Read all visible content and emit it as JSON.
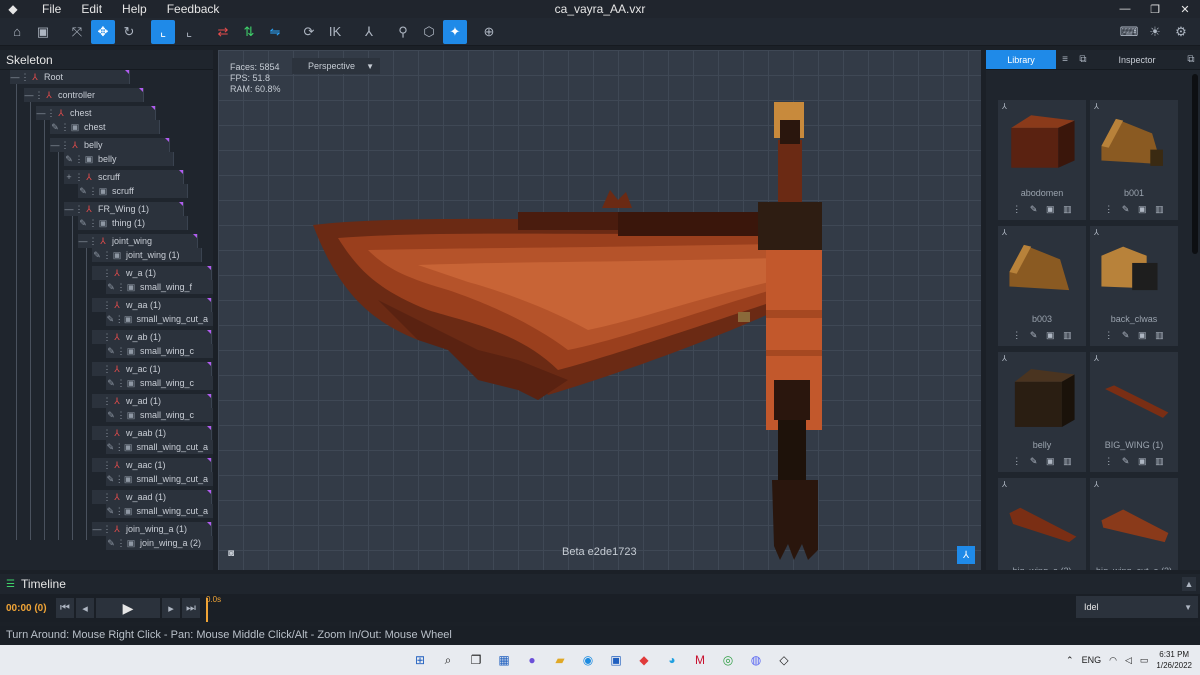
{
  "app": {
    "title": "ca_vayra_AA.vxr",
    "menu": [
      "File",
      "Edit",
      "Help",
      "Feedback"
    ]
  },
  "toolbar": {
    "ik_label": "IK"
  },
  "skeleton": {
    "title": "Skeleton",
    "nodes": [
      {
        "label": "Root"
      },
      {
        "label": "controller"
      },
      {
        "label": "chest"
      },
      {
        "label": "chest"
      },
      {
        "label": "belly"
      },
      {
        "label": "belly"
      },
      {
        "label": "scruff"
      },
      {
        "label": "scruff"
      },
      {
        "label": "FR_Wing (1)"
      },
      {
        "label": "thing (1)"
      },
      {
        "label": "joint_wing"
      },
      {
        "label": "joint_wing (1)"
      },
      {
        "label": "w_a (1)"
      },
      {
        "label": "small_wing_f"
      },
      {
        "label": "w_aa (1)"
      },
      {
        "label": "small_wing_cut_a"
      },
      {
        "label": "w_ab (1)"
      },
      {
        "label": "small_wing_c"
      },
      {
        "label": "w_ac (1)"
      },
      {
        "label": "small_wing_c"
      },
      {
        "label": "w_ad (1)"
      },
      {
        "label": "small_wing_c"
      },
      {
        "label": "w_aab (1)"
      },
      {
        "label": "small_wing_cut_a"
      },
      {
        "label": "w_aac (1)"
      },
      {
        "label": "small_wing_cut_a"
      },
      {
        "label": "w_aad (1)"
      },
      {
        "label": "small_wing_cut_a"
      },
      {
        "label": "join_wing_a (1)"
      },
      {
        "label": "join_wing_a (2)"
      }
    ]
  },
  "viewport": {
    "faces": "Faces: 5854",
    "fps": "FPS: 51.8",
    "ram": "RAM: 60.8%",
    "camera_mode": "Perspective",
    "build": "Beta e2de1723"
  },
  "library": {
    "tab_library": "Library",
    "tab_inspector": "Inspector",
    "items": [
      {
        "name": "abodomen"
      },
      {
        "name": "b001"
      },
      {
        "name": "b003"
      },
      {
        "name": "back_clwas"
      },
      {
        "name": "belly"
      },
      {
        "name": "BIG_WING (1)"
      },
      {
        "name": "big_wing_a (2)"
      },
      {
        "name": "big_wing_cut_a (2)"
      }
    ]
  },
  "timeline": {
    "title": "Timeline",
    "time": "00:00 (0)",
    "marker": "0.0s",
    "animation": "Idel"
  },
  "status": {
    "hint": "Turn Around: Mouse Right Click - Pan: Mouse Middle Click/Alt - Zoom In/Out: Mouse Wheel"
  },
  "taskbar": {
    "lang": "ENG",
    "time": "6:31 PM",
    "date": "1/26/2022"
  }
}
